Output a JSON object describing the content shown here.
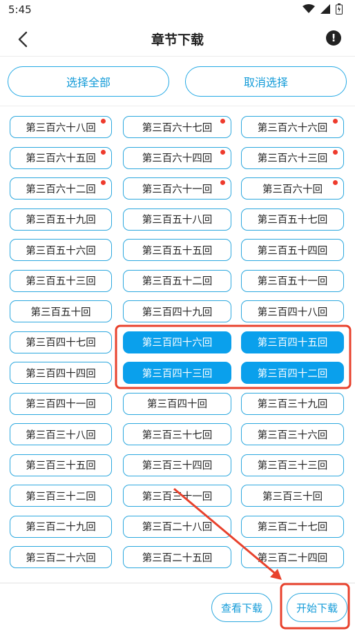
{
  "status": {
    "time": "5:45"
  },
  "header": {
    "title": "章节下载",
    "info_icon": "!"
  },
  "actions": {
    "select_all": "选择全部",
    "cancel_selection": "取消选择"
  },
  "chapters": [
    {
      "label": "第三百六十八回",
      "new": true,
      "selected": false
    },
    {
      "label": "第三百六十七回",
      "new": true,
      "selected": false
    },
    {
      "label": "第三百六十六回",
      "new": true,
      "selected": false
    },
    {
      "label": "第三百六十五回",
      "new": true,
      "selected": false
    },
    {
      "label": "第三百六十四回",
      "new": true,
      "selected": false
    },
    {
      "label": "第三百六十三回",
      "new": true,
      "selected": false
    },
    {
      "label": "第三百六十二回",
      "new": true,
      "selected": false
    },
    {
      "label": "第三百六十一回",
      "new": true,
      "selected": false
    },
    {
      "label": "第三百六十回",
      "new": true,
      "selected": false
    },
    {
      "label": "第三百五十九回",
      "new": false,
      "selected": false
    },
    {
      "label": "第三百五十八回",
      "new": false,
      "selected": false
    },
    {
      "label": "第三百五十七回",
      "new": false,
      "selected": false
    },
    {
      "label": "第三百五十六回",
      "new": false,
      "selected": false
    },
    {
      "label": "第三百五十五回",
      "new": false,
      "selected": false
    },
    {
      "label": "第三百五十四回",
      "new": false,
      "selected": false
    },
    {
      "label": "第三百五十三回",
      "new": false,
      "selected": false
    },
    {
      "label": "第三百五十二回",
      "new": false,
      "selected": false
    },
    {
      "label": "第三百五十一回",
      "new": false,
      "selected": false
    },
    {
      "label": "第三百五十回",
      "new": false,
      "selected": false
    },
    {
      "label": "第三百四十九回",
      "new": false,
      "selected": false
    },
    {
      "label": "第三百四十八回",
      "new": false,
      "selected": false
    },
    {
      "label": "第三百四十七回",
      "new": false,
      "selected": false
    },
    {
      "label": "第三百四十六回",
      "new": false,
      "selected": true
    },
    {
      "label": "第三百四十五回",
      "new": false,
      "selected": true
    },
    {
      "label": "第三百四十四回",
      "new": false,
      "selected": false
    },
    {
      "label": "第三百四十三回",
      "new": false,
      "selected": true
    },
    {
      "label": "第三百四十二回",
      "new": false,
      "selected": true
    },
    {
      "label": "第三百四十一回",
      "new": false,
      "selected": false
    },
    {
      "label": "第三百四十回",
      "new": false,
      "selected": false
    },
    {
      "label": "第三百三十九回",
      "new": false,
      "selected": false
    },
    {
      "label": "第三百三十八回",
      "new": false,
      "selected": false
    },
    {
      "label": "第三百三十七回",
      "new": false,
      "selected": false
    },
    {
      "label": "第三百三十六回",
      "new": false,
      "selected": false
    },
    {
      "label": "第三百三十五回",
      "new": false,
      "selected": false
    },
    {
      "label": "第三百三十四回",
      "new": false,
      "selected": false
    },
    {
      "label": "第三百三十三回",
      "new": false,
      "selected": false
    },
    {
      "label": "第三百三十二回",
      "new": false,
      "selected": false
    },
    {
      "label": "第三百三十一回",
      "new": false,
      "selected": false
    },
    {
      "label": "第三百三十回",
      "new": false,
      "selected": false
    },
    {
      "label": "第三百二十九回",
      "new": false,
      "selected": false
    },
    {
      "label": "第三百二十八回",
      "new": false,
      "selected": false
    },
    {
      "label": "第三百二十七回",
      "new": false,
      "selected": false
    },
    {
      "label": "第三百二十六回",
      "new": false,
      "selected": false
    },
    {
      "label": "第三百二十五回",
      "new": false,
      "selected": false
    },
    {
      "label": "第三百二十四回",
      "new": false,
      "selected": false
    }
  ],
  "bottom": {
    "view_downloads": "查看下载",
    "start_download": "开始下载"
  },
  "colors": {
    "accent": "#0aa0ec",
    "new_dot": "#ee3a2c",
    "annotation": "#e8412c"
  }
}
